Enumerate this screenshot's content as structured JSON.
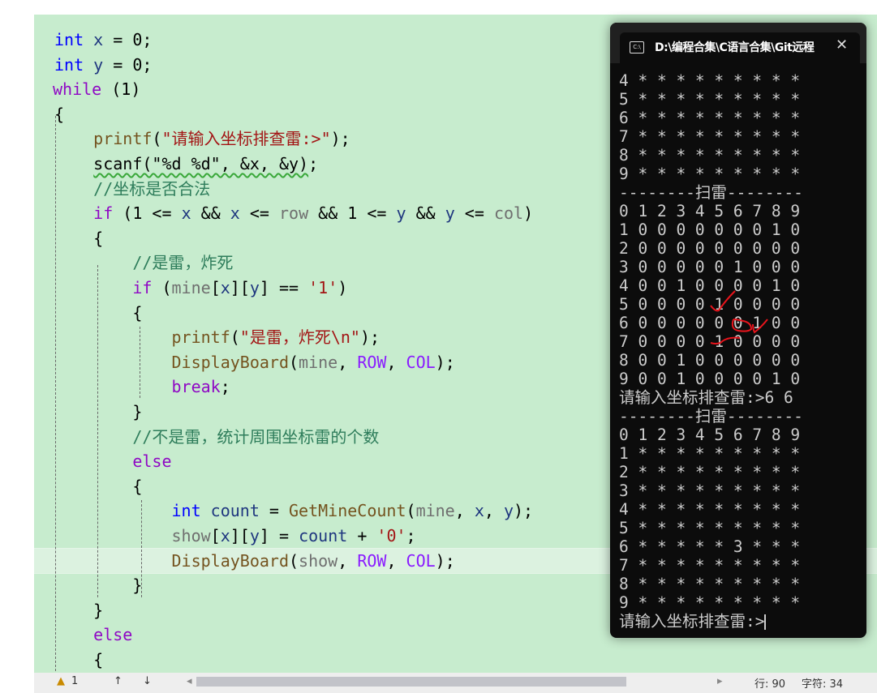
{
  "editor": {
    "lines": [
      [
        {
          "t": "int",
          "c": "kw"
        },
        {
          "t": " x ",
          "c": "var"
        },
        {
          "t": "= 0;",
          "c": "p"
        }
      ],
      [
        {
          "t": "int",
          "c": "kw"
        },
        {
          "t": " y ",
          "c": "var"
        },
        {
          "t": "= 0;",
          "c": "p"
        }
      ],
      [
        {
          "t": "while",
          "c": "ctl"
        },
        {
          "t": " (1)",
          "c": "p"
        }
      ],
      [
        {
          "t": "{",
          "c": "p"
        }
      ],
      [
        {
          "t": "    "
        },
        {
          "t": "printf",
          "c": "fn"
        },
        {
          "t": "(",
          "c": "p"
        },
        {
          "t": "\"请输入坐标排查雷:>\"",
          "c": "str"
        },
        {
          "t": ");",
          "c": "p"
        }
      ],
      [
        {
          "t": "    "
        },
        {
          "t": "scanf(\"%d %d\", &x, &y)",
          "c": "squig"
        },
        {
          "t": ";",
          "c": "p"
        }
      ],
      [
        {
          "t": "    "
        },
        {
          "t": "//坐标是否合法",
          "c": "cmt"
        }
      ],
      [
        {
          "t": "    "
        },
        {
          "t": "if",
          "c": "ctl"
        },
        {
          "t": " (1 <= ",
          "c": "p"
        },
        {
          "t": "x",
          "c": "var"
        },
        {
          "t": " && ",
          "c": "p"
        },
        {
          "t": "x",
          "c": "var"
        },
        {
          "t": " <= ",
          "c": "p"
        },
        {
          "t": "row",
          "c": "mem"
        },
        {
          "t": " && 1 <= ",
          "c": "p"
        },
        {
          "t": "y",
          "c": "var"
        },
        {
          "t": " && ",
          "c": "p"
        },
        {
          "t": "y",
          "c": "var"
        },
        {
          "t": " <= ",
          "c": "p"
        },
        {
          "t": "col",
          "c": "mem"
        },
        {
          "t": ")",
          "c": "p"
        }
      ],
      [
        {
          "t": "    "
        },
        {
          "t": "{",
          "c": "p"
        }
      ],
      [
        {
          "t": "        "
        },
        {
          "t": "//是雷，炸死",
          "c": "cmt"
        }
      ],
      [
        {
          "t": "        "
        },
        {
          "t": "if",
          "c": "ctl"
        },
        {
          "t": " (",
          "c": "p"
        },
        {
          "t": "mine",
          "c": "mem"
        },
        {
          "t": "[",
          "c": "p"
        },
        {
          "t": "x",
          "c": "var"
        },
        {
          "t": "][",
          "c": "p"
        },
        {
          "t": "y",
          "c": "var"
        },
        {
          "t": "] == ",
          "c": "p"
        },
        {
          "t": "'1'",
          "c": "str"
        },
        {
          "t": ")",
          "c": "p"
        }
      ],
      [
        {
          "t": "        "
        },
        {
          "t": "{",
          "c": "p"
        }
      ],
      [
        {
          "t": "            "
        },
        {
          "t": "printf",
          "c": "fn"
        },
        {
          "t": "(",
          "c": "p"
        },
        {
          "t": "\"是雷，炸死\\n\"",
          "c": "str"
        },
        {
          "t": ");",
          "c": "p"
        }
      ],
      [
        {
          "t": "            "
        },
        {
          "t": "DisplayBoard",
          "c": "fn"
        },
        {
          "t": "(",
          "c": "p"
        },
        {
          "t": "mine",
          "c": "mem"
        },
        {
          "t": ", ",
          "c": "p"
        },
        {
          "t": "ROW",
          "c": "mac"
        },
        {
          "t": ", ",
          "c": "p"
        },
        {
          "t": "COL",
          "c": "mac"
        },
        {
          "t": ");",
          "c": "p"
        }
      ],
      [
        {
          "t": "            "
        },
        {
          "t": "break",
          "c": "ctl"
        },
        {
          "t": ";",
          "c": "p"
        }
      ],
      [
        {
          "t": "        "
        },
        {
          "t": "}",
          "c": "p"
        }
      ],
      [
        {
          "t": "        "
        },
        {
          "t": "//不是雷，统计周围坐标雷的个数",
          "c": "cmt"
        }
      ],
      [
        {
          "t": "        "
        },
        {
          "t": "else",
          "c": "ctl"
        }
      ],
      [
        {
          "t": "        "
        },
        {
          "t": "{",
          "c": "p"
        }
      ],
      [
        {
          "t": "            "
        },
        {
          "t": "int",
          "c": "kw"
        },
        {
          "t": " count ",
          "c": "var"
        },
        {
          "t": "= ",
          "c": "p"
        },
        {
          "t": "GetMineCount",
          "c": "fn"
        },
        {
          "t": "(",
          "c": "p"
        },
        {
          "t": "mine",
          "c": "mem"
        },
        {
          "t": ", ",
          "c": "p"
        },
        {
          "t": "x",
          "c": "var"
        },
        {
          "t": ", ",
          "c": "p"
        },
        {
          "t": "y",
          "c": "var"
        },
        {
          "t": ");",
          "c": "p"
        }
      ],
      [
        {
          "t": "            "
        },
        {
          "t": "show",
          "c": "mem"
        },
        {
          "t": "[",
          "c": "p"
        },
        {
          "t": "x",
          "c": "var"
        },
        {
          "t": "][",
          "c": "p"
        },
        {
          "t": "y",
          "c": "var"
        },
        {
          "t": "] = ",
          "c": "p"
        },
        {
          "t": "count",
          "c": "var"
        },
        {
          "t": " + ",
          "c": "p"
        },
        {
          "t": "'0'",
          "c": "str"
        },
        {
          "t": ";",
          "c": "p"
        }
      ],
      [
        {
          "t": "            "
        },
        {
          "t": "DisplayBoard",
          "c": "fn"
        },
        {
          "t": "(",
          "c": "p"
        },
        {
          "t": "show",
          "c": "mem"
        },
        {
          "t": ", ",
          "c": "p"
        },
        {
          "t": "ROW",
          "c": "mac"
        },
        {
          "t": ", ",
          "c": "p"
        },
        {
          "t": "COL",
          "c": "mac"
        },
        {
          "t": ");",
          "c": "p"
        }
      ],
      [
        {
          "t": "        "
        },
        {
          "t": "}",
          "c": "p"
        }
      ],
      [
        {
          "t": "    "
        },
        {
          "t": "}",
          "c": "p"
        }
      ],
      [
        {
          "t": "    "
        },
        {
          "t": "else",
          "c": "ctl"
        }
      ],
      [
        {
          "t": "    "
        },
        {
          "t": "{",
          "c": "p"
        }
      ]
    ],
    "current_line_index": 21
  },
  "console": {
    "title": "D:\\编程合集\\C语言合集\\Git远程",
    "icon": "console-icon",
    "close_icon": "close-icon",
    "lines": [
      "4 * * * * * * * * *",
      "5 * * * * * * * * *",
      "6 * * * * * * * * *",
      "7 * * * * * * * * *",
      "8 * * * * * * * * *",
      "9 * * * * * * * * *",
      "--------扫雷--------",
      "0 1 2 3 4 5 6 7 8 9",
      "1 0 0 0 0 0 0 0 1 0",
      "2 0 0 0 0 0 0 0 0 0",
      "3 0 0 0 0 0 1 0 0 0",
      "4 0 0 1 0 0 0 0 1 0",
      "5 0 0 0 0 1 0 0 0 0",
      "6 0 0 0 0 0 0 1 0 0",
      "7 0 0 0 0 1 0 0 0 0",
      "8 0 0 1 0 0 0 0 0 0",
      "9 0 0 1 0 0 0 0 1 0",
      "请输入坐标排查雷:>6 6",
      "--------扫雷--------",
      "0 1 2 3 4 5 6 7 8 9",
      "1 * * * * * * * * *",
      "2 * * * * * * * * *",
      "3 * * * * * * * * *",
      "4 * * * * * * * * *",
      "5 * * * * * * * * *",
      "6 * * * * * 3 * * *",
      "7 * * * * * * * * *",
      "8 * * * * * * * * *",
      "9 * * * * * * * * *",
      "请输入坐标排查雷:>"
    ],
    "annotation_color": "#e8141c"
  },
  "statusbar": {
    "warnings": "1",
    "warning_icon": "warning-icon",
    "up": "↑",
    "down": "↓",
    "line": "行: 90",
    "char": "字符: 34"
  }
}
